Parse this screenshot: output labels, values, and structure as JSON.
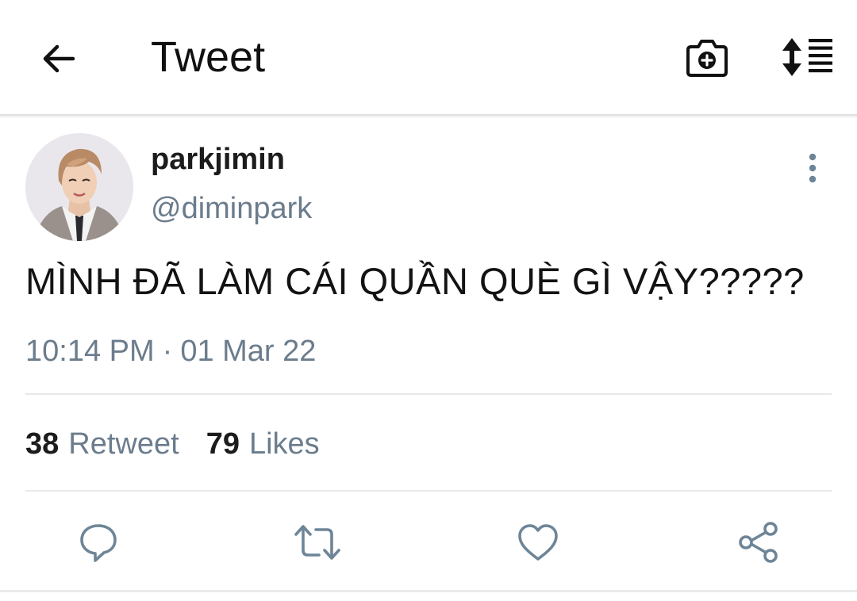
{
  "header": {
    "title": "Tweet",
    "back_icon": "arrow-left-icon",
    "camera_icon": "camera-plus-icon",
    "sort_icon": "sort-list-icon"
  },
  "tweet": {
    "display_name": "parkjimin",
    "handle": "@diminpark",
    "text": "MÌNH ĐÃ LÀM CÁI QUẦN QUÈ GÌ VẬY?????",
    "time": "10:14 PM",
    "separator": "·",
    "date": "01 Mar 22"
  },
  "stats": {
    "retweets_count": "38",
    "retweets_label": "Retweet",
    "likes_count": "79",
    "likes_label": "Likes"
  },
  "actions": {
    "reply_icon": "reply-bubble-icon",
    "retweet_icon": "retweet-icon",
    "like_icon": "heart-icon",
    "share_icon": "share-icon"
  },
  "colors": {
    "text_primary": "#131313",
    "text_secondary": "#6b7c8c",
    "icon_action": "#6e8597",
    "divider": "#e6e8ea"
  }
}
